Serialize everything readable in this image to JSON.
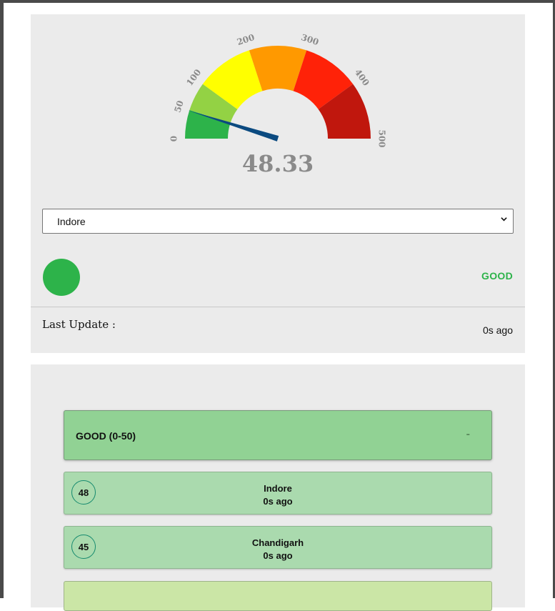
{
  "gauge": {
    "value": 48.33,
    "value_text": "48.33",
    "min": 0,
    "max": 500,
    "tick_labels": [
      "0",
      "50",
      "100",
      "200",
      "300",
      "400",
      "500"
    ],
    "tick_values": [
      0,
      50,
      100,
      200,
      300,
      400,
      500
    ],
    "bands": [
      {
        "from": 0,
        "to": 50,
        "color": "#2db34a"
      },
      {
        "from": 50,
        "to": 100,
        "color": "#93d244"
      },
      {
        "from": 100,
        "to": 200,
        "color": "#ffff00"
      },
      {
        "from": 200,
        "to": 300,
        "color": "#ff9900"
      },
      {
        "from": 300,
        "to": 400,
        "color": "#ff2208"
      },
      {
        "from": 400,
        "to": 500,
        "color": "#c0170d"
      }
    ],
    "needle_color": "#0b4a80",
    "tick_color": "#8a8a8a"
  },
  "city_select": {
    "selected": "Indore"
  },
  "status": {
    "label": "GOOD",
    "color": "#2db34a"
  },
  "last_update": {
    "label": "Last Update :",
    "value": "0s ago"
  },
  "category": {
    "label": "GOOD (0-50)",
    "collapse_symbol": "-"
  },
  "rows": [
    {
      "aqi": "48",
      "city": "Indore",
      "time": "0s ago"
    },
    {
      "aqi": "45",
      "city": "Chandigarh",
      "time": "0s ago"
    }
  ]
}
